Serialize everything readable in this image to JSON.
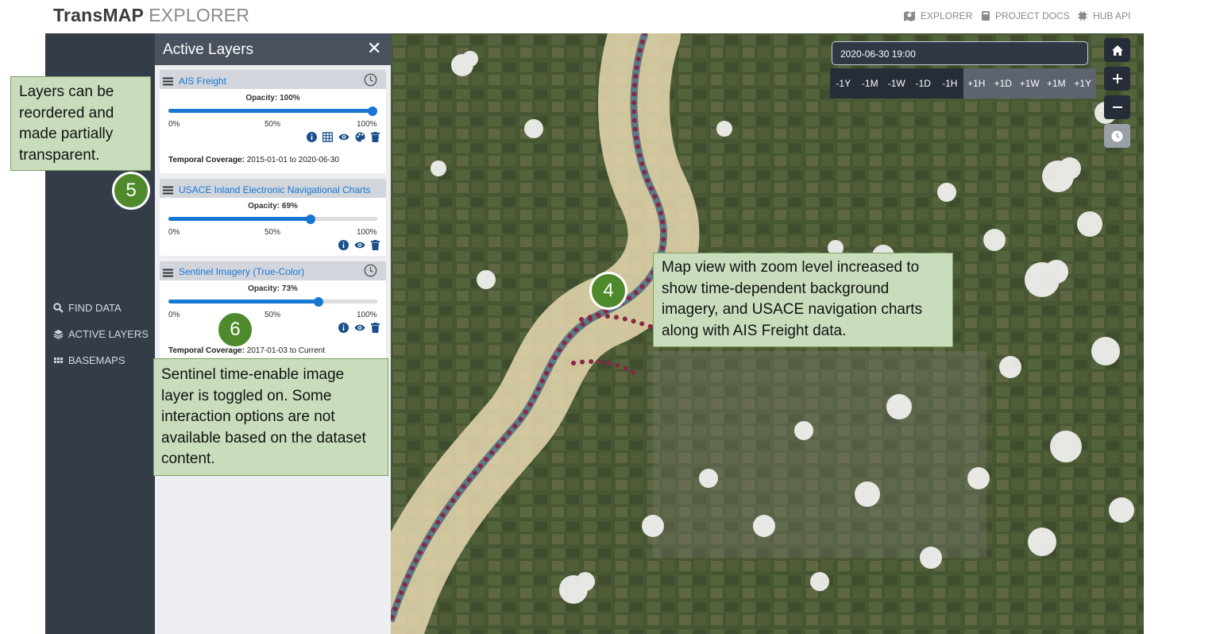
{
  "header": {
    "brand_main": "TransMAP",
    "brand_sub": "EXPLORER",
    "nav": [
      {
        "label": "EXPLORER",
        "icon": "map-icon"
      },
      {
        "label": "PROJECT DOCS",
        "icon": "book-icon"
      },
      {
        "label": "HUB API",
        "icon": "chip-icon"
      }
    ]
  },
  "sidebar": {
    "items": [
      {
        "label": "FIND DATA",
        "icon": "search-icon"
      },
      {
        "label": "ACTIVE LAYERS",
        "icon": "layers-icon"
      },
      {
        "label": "BASEMAPS",
        "icon": "grid-icon"
      }
    ]
  },
  "panel": {
    "title": "Active Layers",
    "close": "✕",
    "opacity_label": "Opacity:",
    "temporal_label": "Temporal Coverage:",
    "tick_min": "0%",
    "tick_mid": "50%",
    "tick_max": "100%",
    "layers": [
      {
        "name": "AIS Freight",
        "opacity": "100%",
        "opacity_value": 1.0,
        "temporal": "2015-01-01 to 2020-06-30"
      },
      {
        "name": "USACE Inland Electronic Navigational Charts",
        "opacity": "69%",
        "opacity_value": 0.69
      },
      {
        "name": "Sentinel Imagery (True-Color)",
        "opacity": "73%",
        "opacity_value": 0.73,
        "temporal": "2017-01-03 to Current"
      }
    ]
  },
  "time_control": {
    "datetime": "2020-06-30 19:00",
    "steps_back": [
      "-1Y",
      "-1M",
      "-1W",
      "-1D",
      "-1H"
    ],
    "steps_forward": [
      "+1H",
      "+1D",
      "+1W",
      "+1M",
      "+1Y"
    ]
  },
  "annotations": {
    "note5": "Layers can be reordered and made partially transparent.",
    "note6": "Sentinel time-enable image layer is toggled on. Some interaction options are not available based on the dataset content.",
    "note4": "Map view with zoom level increased to show time-dependent background imagery, and USACE navigation charts along with AIS Freight data.",
    "badge4": "4",
    "badge5": "5",
    "badge6": "6"
  },
  "colors": {
    "sidebar": "#343c48",
    "accent": "#1877d2",
    "note_bg": "#c9ddbc",
    "badge": "#4e8a2c"
  }
}
